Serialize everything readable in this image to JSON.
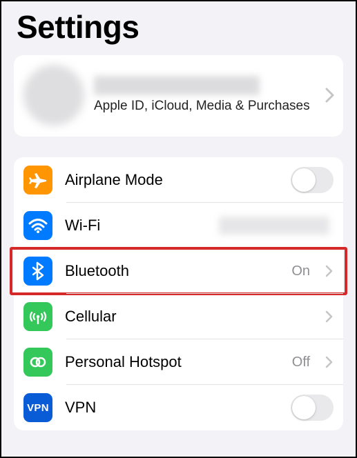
{
  "title": "Settings",
  "profile": {
    "subtitle": "Apple ID, iCloud, Media & Purchases"
  },
  "rows": {
    "airplane": {
      "label": "Airplane Mode"
    },
    "wifi": {
      "label": "Wi-Fi"
    },
    "bluetooth": {
      "label": "Bluetooth",
      "value": "On"
    },
    "cellular": {
      "label": "Cellular"
    },
    "hotspot": {
      "label": "Personal Hotspot",
      "value": "Off"
    },
    "vpn": {
      "label": "VPN"
    }
  }
}
